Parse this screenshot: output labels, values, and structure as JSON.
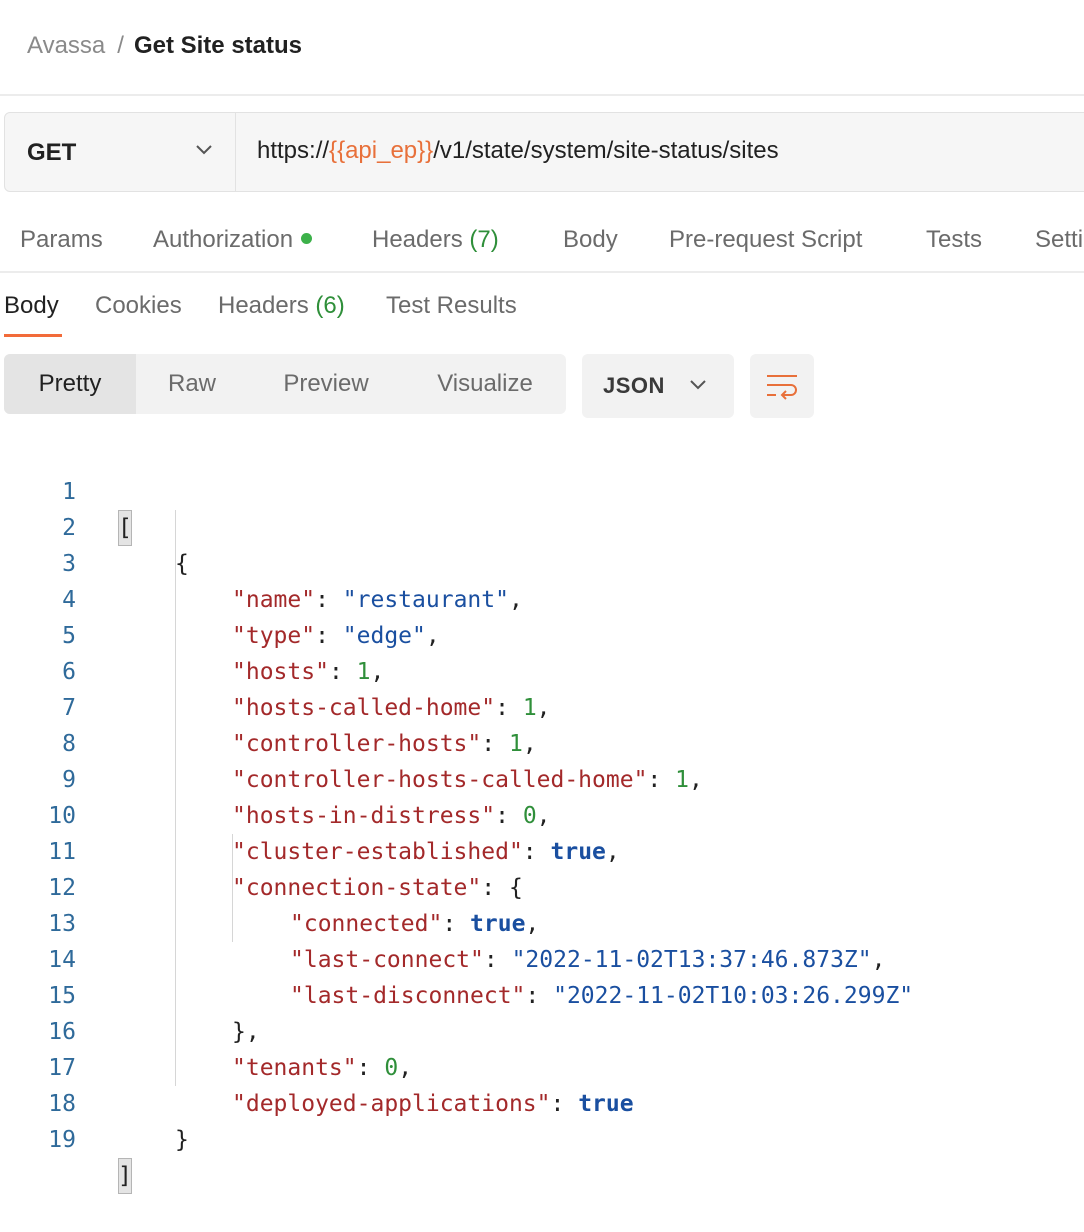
{
  "breadcrumb": {
    "parent": "Avassa",
    "separator": "/",
    "current": "Get Site status"
  },
  "request": {
    "method": "GET",
    "url_prefix": "https://",
    "url_variable": "{{api_ep}}",
    "url_suffix": "/v1/state/system/site-status/sites"
  },
  "request_tabs": {
    "params": "Params",
    "authorization": "Authorization",
    "headers": "Headers",
    "headers_count": "(7)",
    "body": "Body",
    "prerequest": "Pre-request Script",
    "tests": "Tests",
    "settings": "Setti"
  },
  "response_tabs": {
    "body": "Body",
    "cookies": "Cookies",
    "headers": "Headers",
    "headers_count": "(6)",
    "test_results": "Test Results"
  },
  "view_modes": {
    "pretty": "Pretty",
    "raw": "Raw",
    "preview": "Preview",
    "visualize": "Visualize"
  },
  "format": "JSON",
  "icons": {
    "method_dropdown": "chevron-down-icon",
    "format_dropdown": "chevron-down-icon",
    "wrap": "wrap-lines-icon",
    "auth_status": "status-dot-icon"
  },
  "colors": {
    "accent": "#f26b3a",
    "url_variable": "#e8703a",
    "auth_dot": "#3cb14a",
    "count": "#2f8f3a",
    "json_key": "#a3292a",
    "json_string": "#1a4fa0",
    "json_number": "#2f8f3a",
    "line_number": "#2f6a9a"
  },
  "code": {
    "line_numbers": [
      "1",
      "2",
      "3",
      "4",
      "5",
      "6",
      "7",
      "8",
      "9",
      "10",
      "11",
      "12",
      "13",
      "14",
      "15",
      "16",
      "17",
      "18",
      "19"
    ],
    "open_array": "[",
    "open_object": "{",
    "colon": ": ",
    "comma": ",",
    "close_nested": "},",
    "close_object": "}",
    "close_array": "]",
    "fields": {
      "name": {
        "key": "\"name\"",
        "value": "\"restaurant\""
      },
      "type": {
        "key": "\"type\"",
        "value": "\"edge\""
      },
      "hosts": {
        "key": "\"hosts\"",
        "value": "1"
      },
      "hosts_called_home": {
        "key": "\"hosts-called-home\"",
        "value": "1"
      },
      "controller_hosts": {
        "key": "\"controller-hosts\"",
        "value": "1"
      },
      "controller_hosts_called_home": {
        "key": "\"controller-hosts-called-home\"",
        "value": "1"
      },
      "hosts_in_distress": {
        "key": "\"hosts-in-distress\"",
        "value": "0"
      },
      "cluster_established": {
        "key": "\"cluster-established\"",
        "value": "true"
      },
      "connection_state": {
        "key": "\"connection-state\"",
        "value": "{"
      },
      "connected": {
        "key": "\"connected\"",
        "value": "true"
      },
      "last_connect": {
        "key": "\"last-connect\"",
        "value": "\"2022-11-02T13:37:46.873Z\""
      },
      "last_disconnect": {
        "key": "\"last-disconnect\"",
        "value": "\"2022-11-02T10:03:26.299Z\""
      },
      "tenants": {
        "key": "\"tenants\"",
        "value": "0"
      },
      "deployed_applications": {
        "key": "\"deployed-applications\"",
        "value": "true"
      }
    }
  }
}
